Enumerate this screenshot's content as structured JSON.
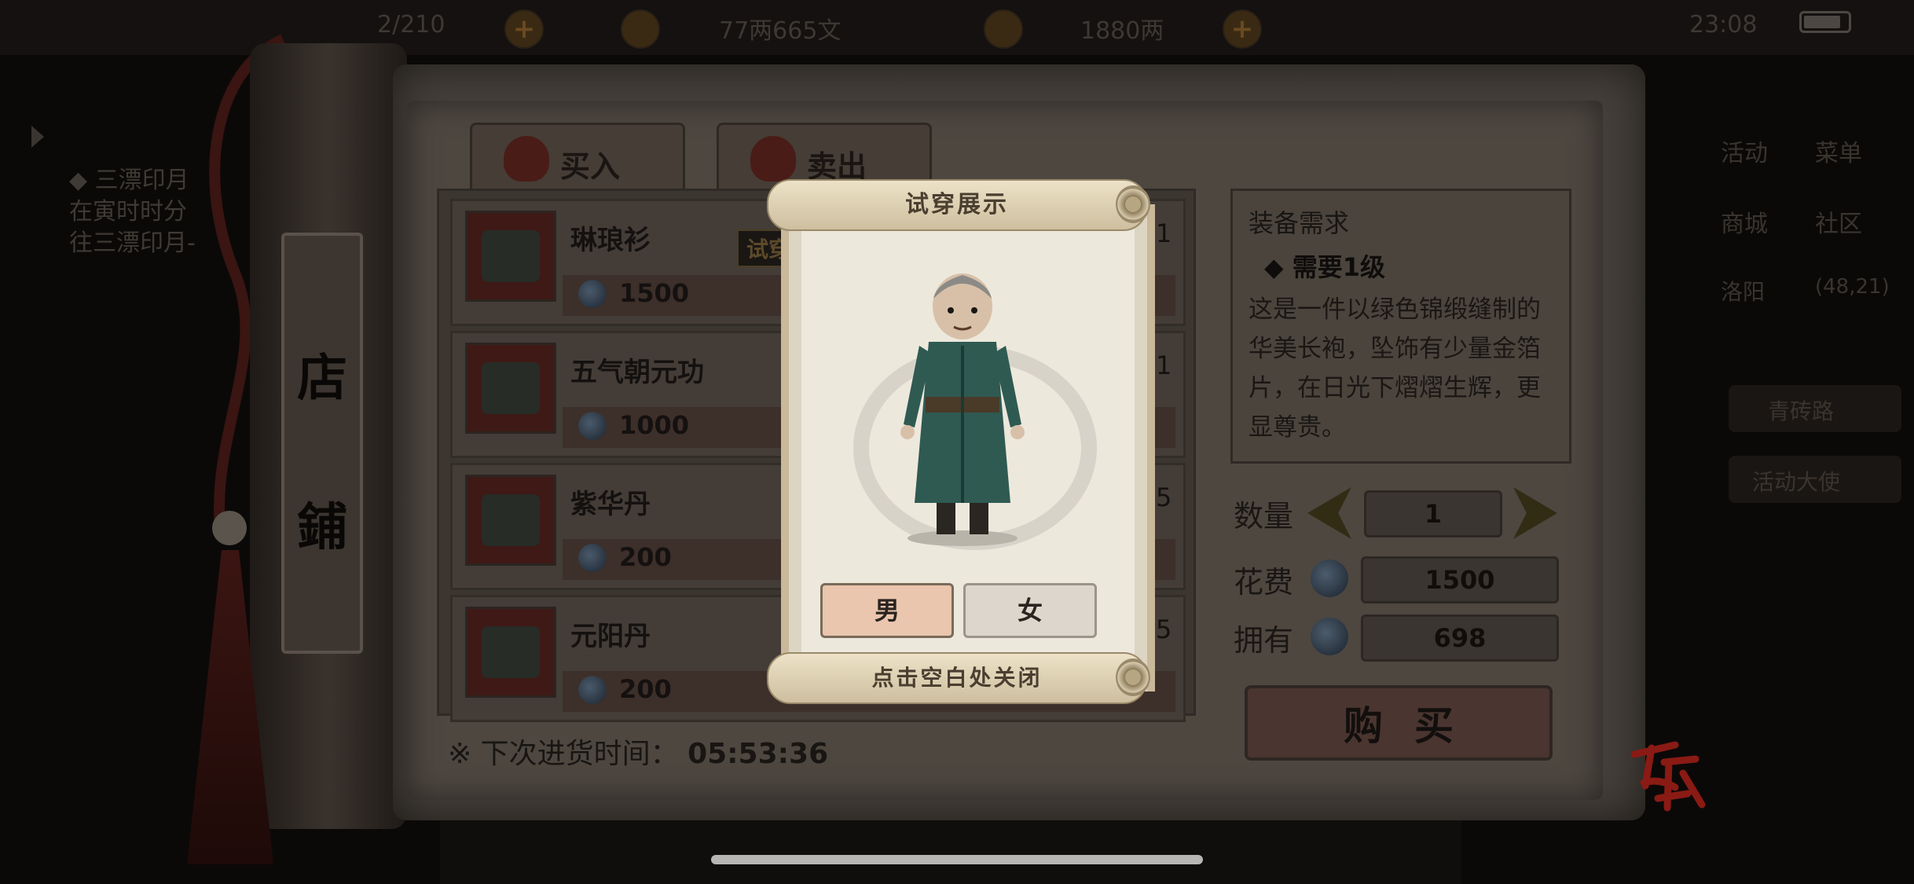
{
  "status_bar": {
    "level_text": "2/210",
    "money": "77两665文",
    "ingot": "1880两",
    "time": "23:08"
  },
  "quest": {
    "title": "◆ 三漂印月",
    "line1": "在寅时时分",
    "line2": "往三漂印月-"
  },
  "right_menu": {
    "activity": "活动",
    "menu": "菜单",
    "mall": "商城",
    "community": "社区",
    "location": "洛阳",
    "coords": "(48,21)",
    "map_item_1": "青砖路",
    "map_item_2": "活动大使"
  },
  "shop": {
    "plate_chars": [
      "店",
      "鋪"
    ],
    "tabs": {
      "buy": "买入",
      "sell": "卖出"
    },
    "try_on_tag": "试穿",
    "items": [
      {
        "name": "琳琅衫",
        "price": "1500",
        "qty": "1"
      },
      {
        "name": "五气朝元功",
        "price": "1000",
        "qty": "1"
      },
      {
        "name": "紫华丹",
        "price": "200",
        "qty": "5"
      },
      {
        "name": "元阳丹",
        "price": "200",
        "qty": "5"
      }
    ],
    "restock_label": "※ 下次进货时间：",
    "restock_time": "05:53:36"
  },
  "detail": {
    "header": "装备需求",
    "requirement": "◆ 需要1级",
    "description": "这是一件以绿色锦缎缝制的华美长袍，坠饰有少量金箔片，在日光下熠熠生辉，更显尊贵。",
    "qty_label": "数量",
    "qty_value": "1",
    "cost_label": "花费",
    "cost_value": "1500",
    "own_label": "拥有",
    "own_value": "698",
    "buy_button": "购买"
  },
  "try_on": {
    "title": "试穿展示",
    "male": "男",
    "female": "女",
    "close_hint": "点击空白处关闭"
  },
  "colors": {
    "male_selected": "#e9c6ad",
    "female_unselected": "#dcd6cc",
    "logo_red": "#8a1a14"
  }
}
